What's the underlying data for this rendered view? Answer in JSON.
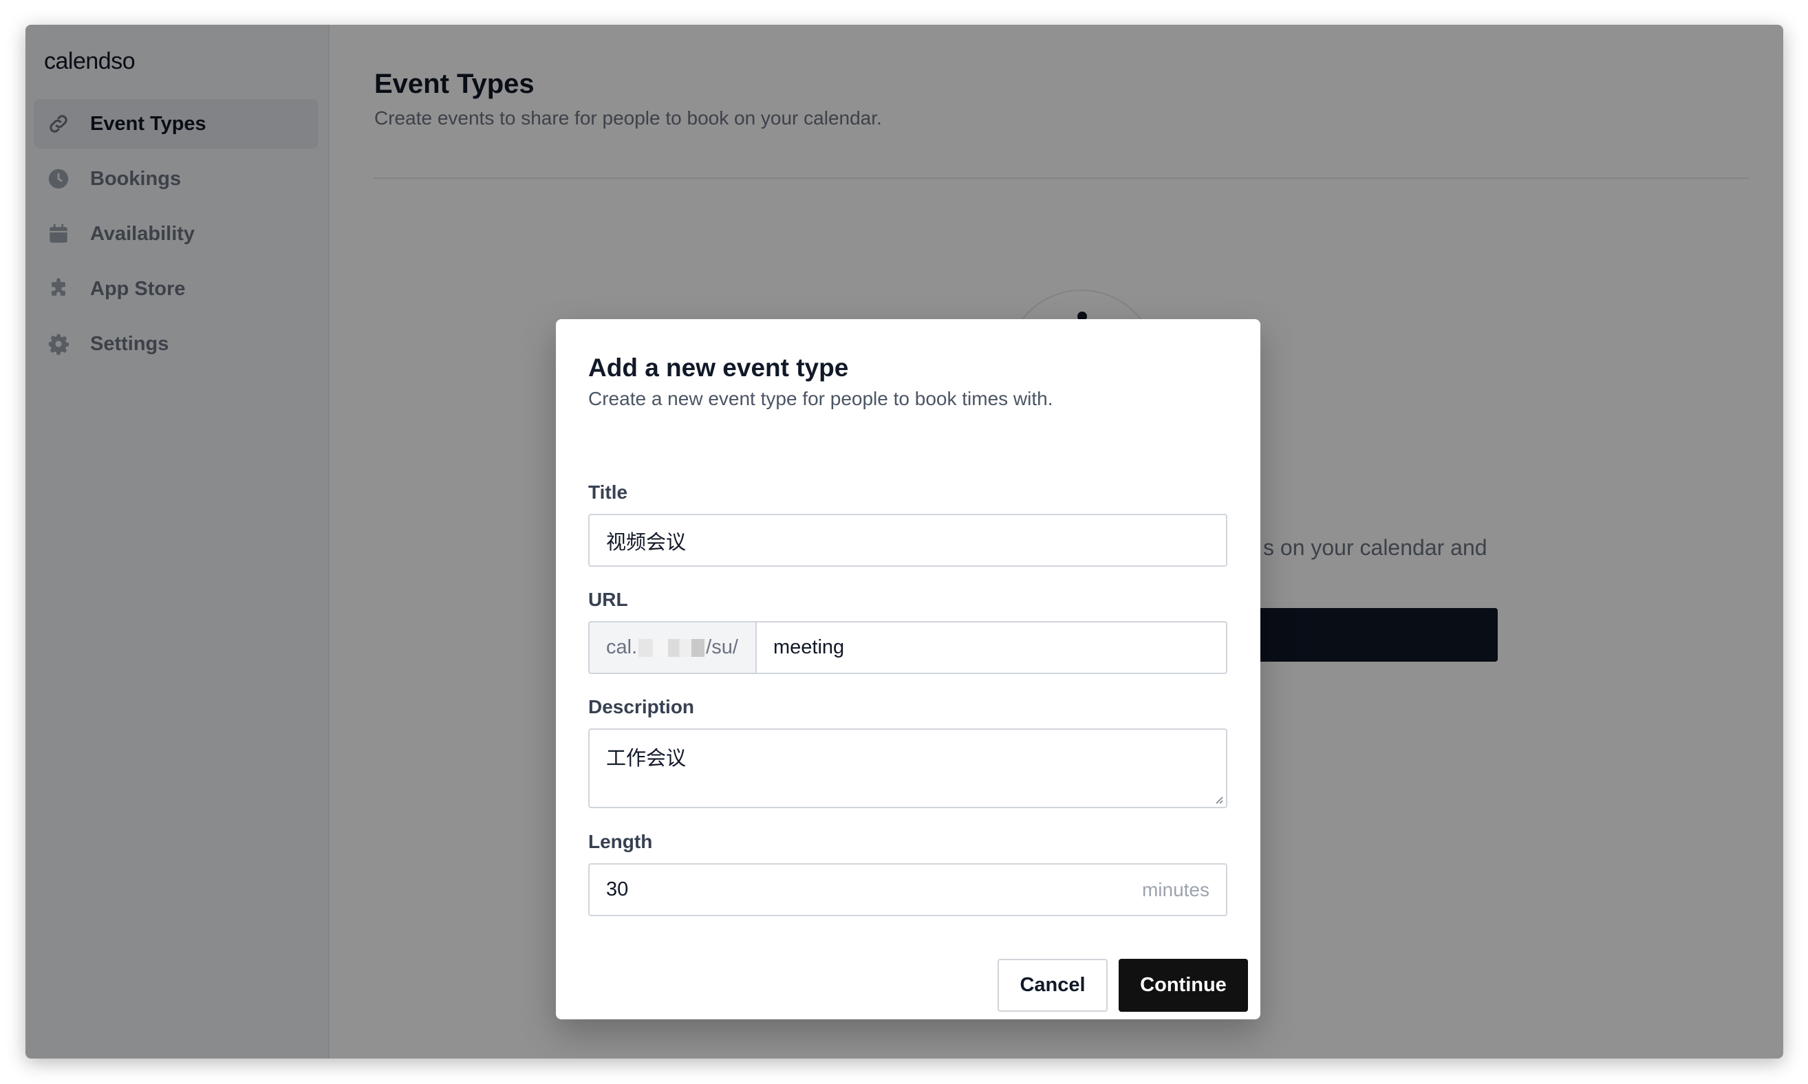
{
  "app": {
    "logo": "calendso"
  },
  "sidebar": {
    "items": [
      {
        "label": "Event Types",
        "icon": "link-icon",
        "active": true
      },
      {
        "label": "Bookings",
        "icon": "clock-icon",
        "active": false
      },
      {
        "label": "Availability",
        "icon": "calendar-icon",
        "active": false
      },
      {
        "label": "App Store",
        "icon": "puzzle-icon",
        "active": false
      },
      {
        "label": "Settings",
        "icon": "gear-icon",
        "active": false
      }
    ]
  },
  "page": {
    "title": "Event Types",
    "subtitle": "Create events to share for people to book on your calendar.",
    "empty_text_visible": "s on your calendar and"
  },
  "modal": {
    "title": "Add a new event type",
    "subtitle": "Create a new event type for people to book times with.",
    "title_field": {
      "label": "Title",
      "value": "视频会议"
    },
    "url_field": {
      "label": "URL",
      "prefix_start": "cal.",
      "prefix_end": "/su/",
      "value": "meeting"
    },
    "description_field": {
      "label": "Description",
      "value": "工作会议"
    },
    "length_field": {
      "label": "Length",
      "value": "30",
      "suffix": "minutes"
    },
    "cancel_label": "Cancel",
    "continue_label": "Continue"
  }
}
